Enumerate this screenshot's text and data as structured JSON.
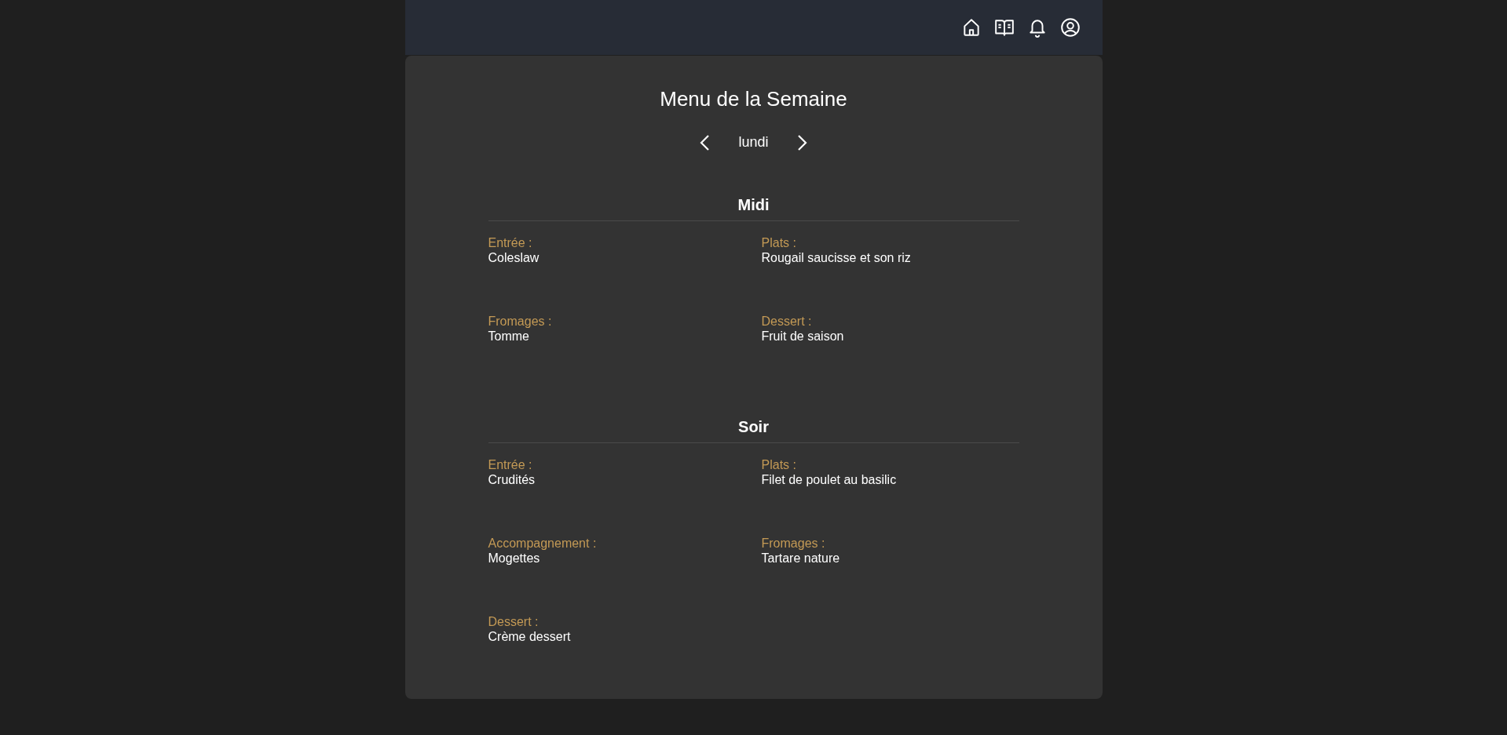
{
  "title": "Menu de la Semaine",
  "day": "lundi",
  "sections": [
    {
      "heading": "Midi",
      "items": [
        {
          "label": "Entrée :",
          "value": "Coleslaw"
        },
        {
          "label": "Plats :",
          "value": "Rougail saucisse et son riz"
        },
        {
          "label": "Fromages :",
          "value": "Tomme"
        },
        {
          "label": "Dessert :",
          "value": "Fruit de saison"
        }
      ]
    },
    {
      "heading": "Soir",
      "items": [
        {
          "label": "Entrée :",
          "value": "Crudités"
        },
        {
          "label": "Plats :",
          "value": "Filet de poulet au basilic"
        },
        {
          "label": "Accompagnement :",
          "value": "Mogettes"
        },
        {
          "label": "Fromages :",
          "value": "Tartare nature"
        },
        {
          "label": "Dessert :",
          "value": "Crème dessert"
        }
      ]
    }
  ]
}
